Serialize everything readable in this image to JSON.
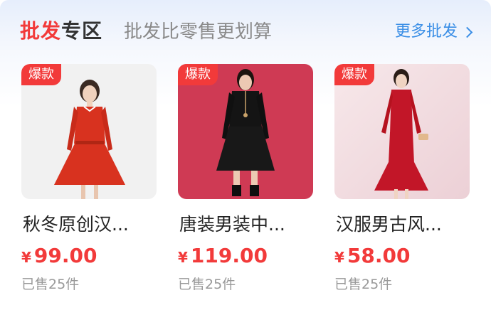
{
  "header": {
    "title_highlight": "批发",
    "title_rest": "专区",
    "subtitle": "批发比零售更划算",
    "more_label": "更多批发"
  },
  "products": [
    {
      "badge": "爆款",
      "name": "秋冬原创汉...",
      "currency": "¥",
      "price": "99.00",
      "sold": "已售25件",
      "dress_color": "#d8321f",
      "bg_color": "#f1f1f1"
    },
    {
      "badge": "爆款",
      "name": "唐装男装中...",
      "currency": "¥",
      "price": "119.00",
      "sold": "已售25件",
      "dress_color": "#141414",
      "bg_color": "#cf3a54"
    },
    {
      "badge": "爆款",
      "name": "汉服男古风...",
      "currency": "¥",
      "price": "58.00",
      "sold": "已售25件",
      "dress_color": "#c21628",
      "bg_color": "#f3dfe3"
    }
  ],
  "colors": {
    "accent": "#f23a3a",
    "link": "#3a8ee6"
  }
}
